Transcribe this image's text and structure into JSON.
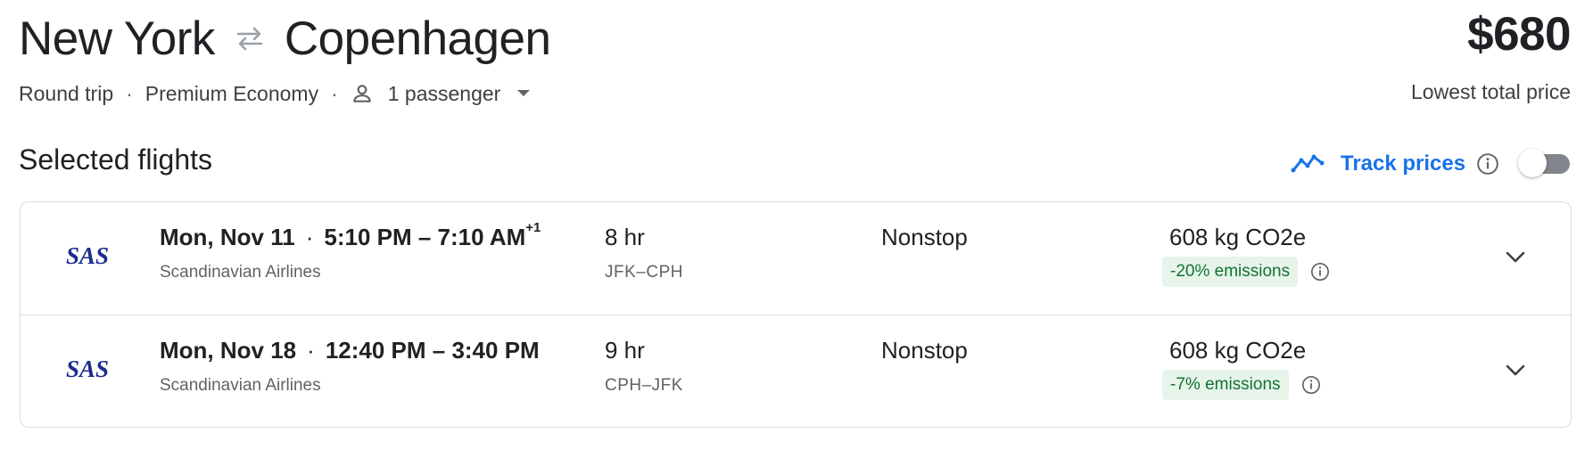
{
  "header": {
    "origin": "New York",
    "destination": "Copenhagen",
    "price": "$680",
    "price_caption": "Lowest total price",
    "trip_type": "Round trip",
    "separator": "·",
    "cabin_class": "Premium Economy",
    "passengers": "1 passenger"
  },
  "section": {
    "title": "Selected flights",
    "track_prices_label": "Track prices",
    "track_prices_enabled": false
  },
  "flights": [
    {
      "date": "Mon, Nov 11",
      "time_range": "5:10 PM – 7:10 AM",
      "day_offset": "+1",
      "airline": "Scandinavian Airlines",
      "airline_logo_text": "SAS",
      "duration": "8 hr",
      "airports": "JFK–CPH",
      "stops": "Nonstop",
      "emissions": "608 kg CO2e",
      "emissions_change": "-20% emissions"
    },
    {
      "date": "Mon, Nov 18",
      "time_range": "12:40 PM – 3:40 PM",
      "day_offset": "",
      "airline": "Scandinavian Airlines",
      "airline_logo_text": "SAS",
      "duration": "9 hr",
      "airports": "CPH–JFK",
      "stops": "Nonstop",
      "emissions": "608 kg CO2e",
      "emissions_change": "-7% emissions"
    }
  ],
  "colors": {
    "accent": "#1a73e8",
    "text_primary": "#202124",
    "text_secondary": "#5f6368",
    "emissions_badge_bg": "#e6f4ea",
    "emissions_badge_text": "#137333",
    "sas_logo": "#1d2c8e"
  },
  "icons": {
    "swap": "swap-arrows-icon",
    "person": "person-icon",
    "dropdown": "dropdown-caret-icon",
    "track": "trend-line-icon",
    "info": "info-icon",
    "expand": "chevron-down-icon"
  }
}
